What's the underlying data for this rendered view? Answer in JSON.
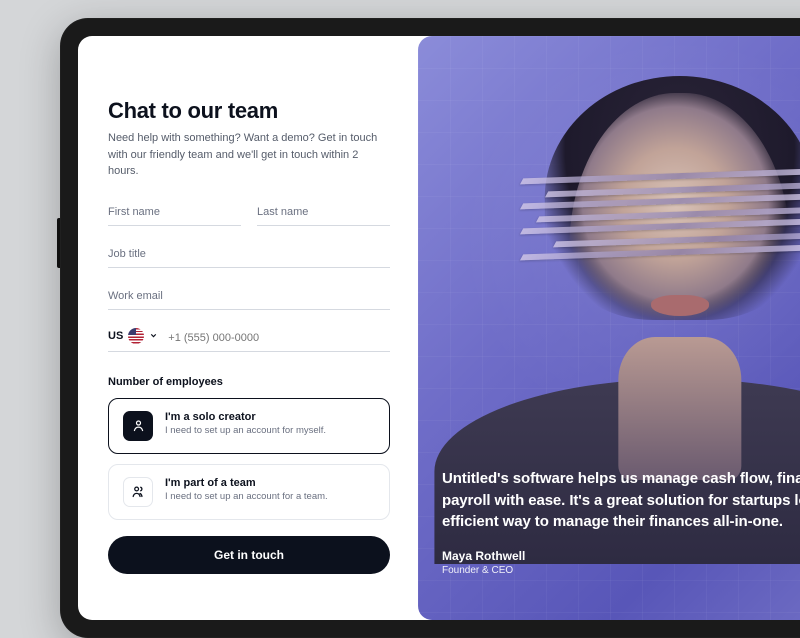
{
  "form": {
    "title": "Chat to our team",
    "description": "Need help with something? Want a demo? Get in touch with our friendly team and we'll get in touch within 2 hours.",
    "first_name_placeholder": "First name",
    "last_name_placeholder": "Last name",
    "job_title_placeholder": "Job title",
    "work_email_placeholder": "Work email",
    "phone": {
      "country_code": "US",
      "placeholder": "+1 (555) 000-0000"
    },
    "employees_label": "Number of employees",
    "options": [
      {
        "title": "I'm a solo creator",
        "desc": "I need to set up an account for myself."
      },
      {
        "title": "I'm part of a team",
        "desc": "I need to set up an account for a team."
      }
    ],
    "submit_label": "Get in touch"
  },
  "testimonial": {
    "quote": "Untitled's software helps us manage cash flow, financial reporting and payroll with ease. It's a great solution for startups looking for an efficient way to manage their finances all-in-one.",
    "name": "Maya Rothwell",
    "role": "Founder & CEO"
  }
}
